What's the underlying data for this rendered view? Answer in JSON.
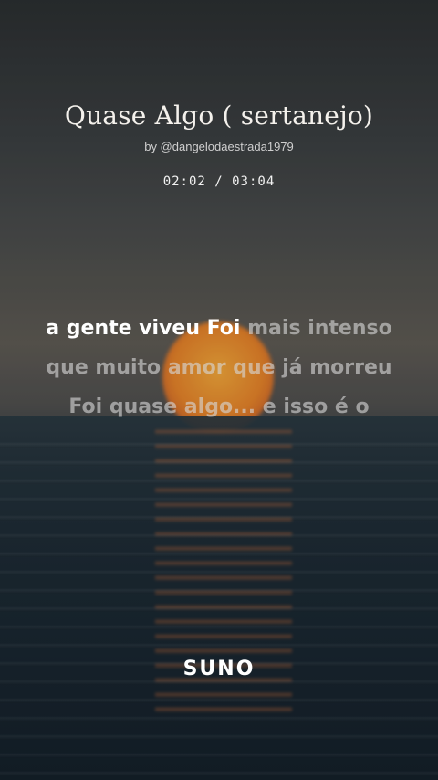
{
  "song": {
    "title": "Quase Algo ( sertanejo)",
    "byline": "by @dangelodaestrada1979",
    "time": "02:02 / 03:04"
  },
  "lyrics": {
    "line1_sung": "a gente viveu Foi",
    "line1_rest": " mais intenso",
    "line2": "que muito amor que já morreu",
    "line3": "Foi quase algo... e isso é o"
  },
  "brand": {
    "logo": "SUNO"
  },
  "colors": {
    "sung": "#ffffff",
    "unsung": "#d7d7d7",
    "sun": "#e4822a"
  }
}
